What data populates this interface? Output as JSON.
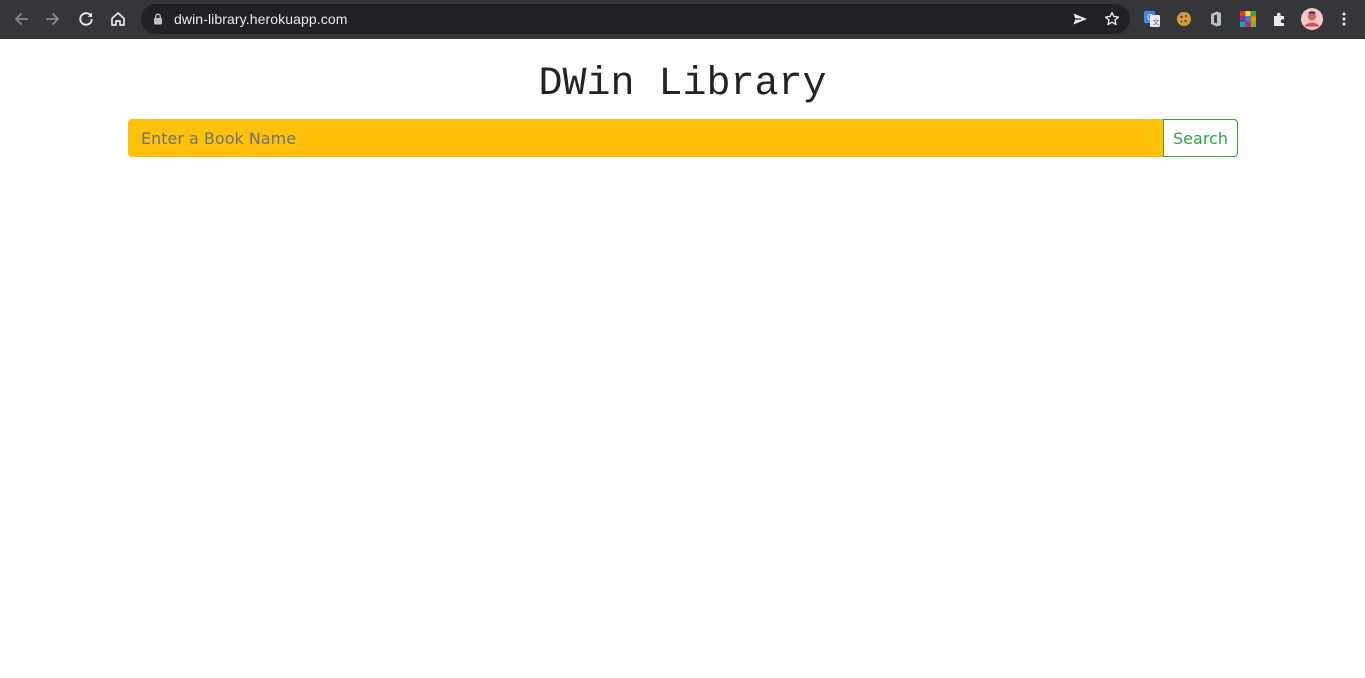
{
  "browser": {
    "url": "dwin-library.herokuapp.com",
    "icons": {
      "back": "back-arrow-icon",
      "forward": "forward-arrow-icon",
      "reload": "reload-icon",
      "home": "home-icon",
      "lock": "lock-icon",
      "send": "send-tab-icon",
      "bookmark": "star-icon",
      "extensions": [
        "google-translate-icon",
        "cookie-icon",
        "office-icon",
        "colorful-grid-icon",
        "puzzle-extensions-icon",
        "profile-avatar",
        "kebab-menu-icon"
      ]
    }
  },
  "page": {
    "title": "DWin Library",
    "search": {
      "placeholder": "Enter a Book Name",
      "value": "",
      "button_label": "Search"
    },
    "colors": {
      "input_background": "#ffc107",
      "button_accent": "#28a745",
      "title_text": "#212529"
    }
  }
}
